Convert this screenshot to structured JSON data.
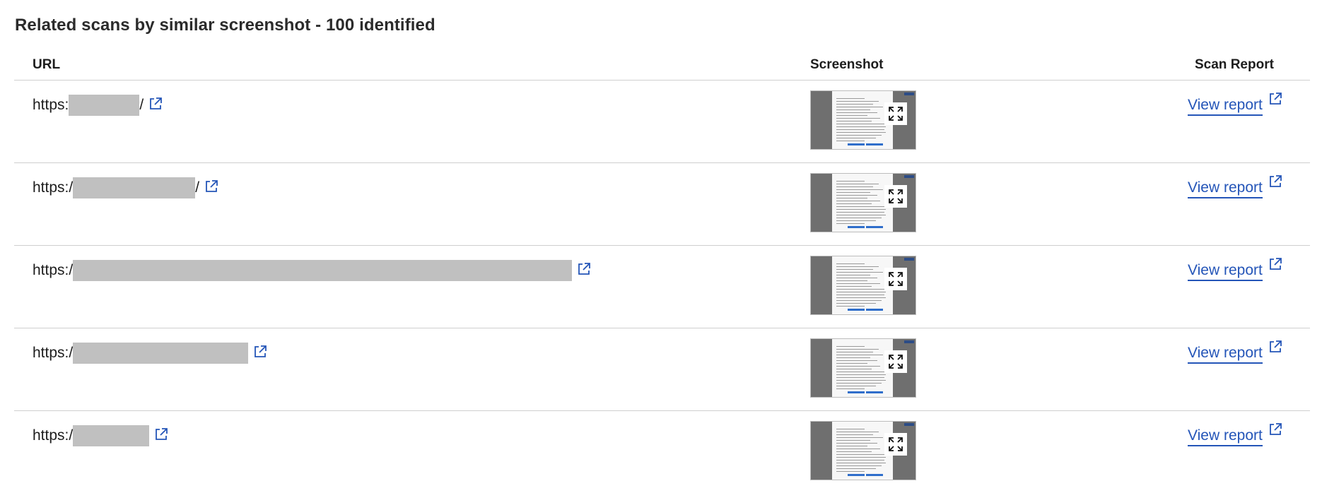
{
  "section": {
    "title": "Related scans by similar screenshot - 100 identified"
  },
  "table": {
    "headers": {
      "url": "URL",
      "screenshot": "Screenshot",
      "scan_report": "Scan Report"
    },
    "rows": [
      {
        "url_prefix": "https:",
        "url_suffix": "/",
        "report_label": "View report"
      },
      {
        "url_prefix": "https:/",
        "url_suffix": "/",
        "report_label": "View report"
      },
      {
        "url_prefix": "https:/",
        "url_suffix": "",
        "report_label": "View report"
      },
      {
        "url_prefix": "https:/",
        "url_suffix": "",
        "report_label": "View report"
      },
      {
        "url_prefix": "https:/",
        "url_suffix": "",
        "report_label": "View report"
      }
    ]
  },
  "icons": {
    "external_link": "external-link-icon",
    "expand": "expand-icon"
  },
  "colors": {
    "link": "#2455b8",
    "redaction": "#c0c0c0",
    "divider": "#cfcfcf"
  }
}
